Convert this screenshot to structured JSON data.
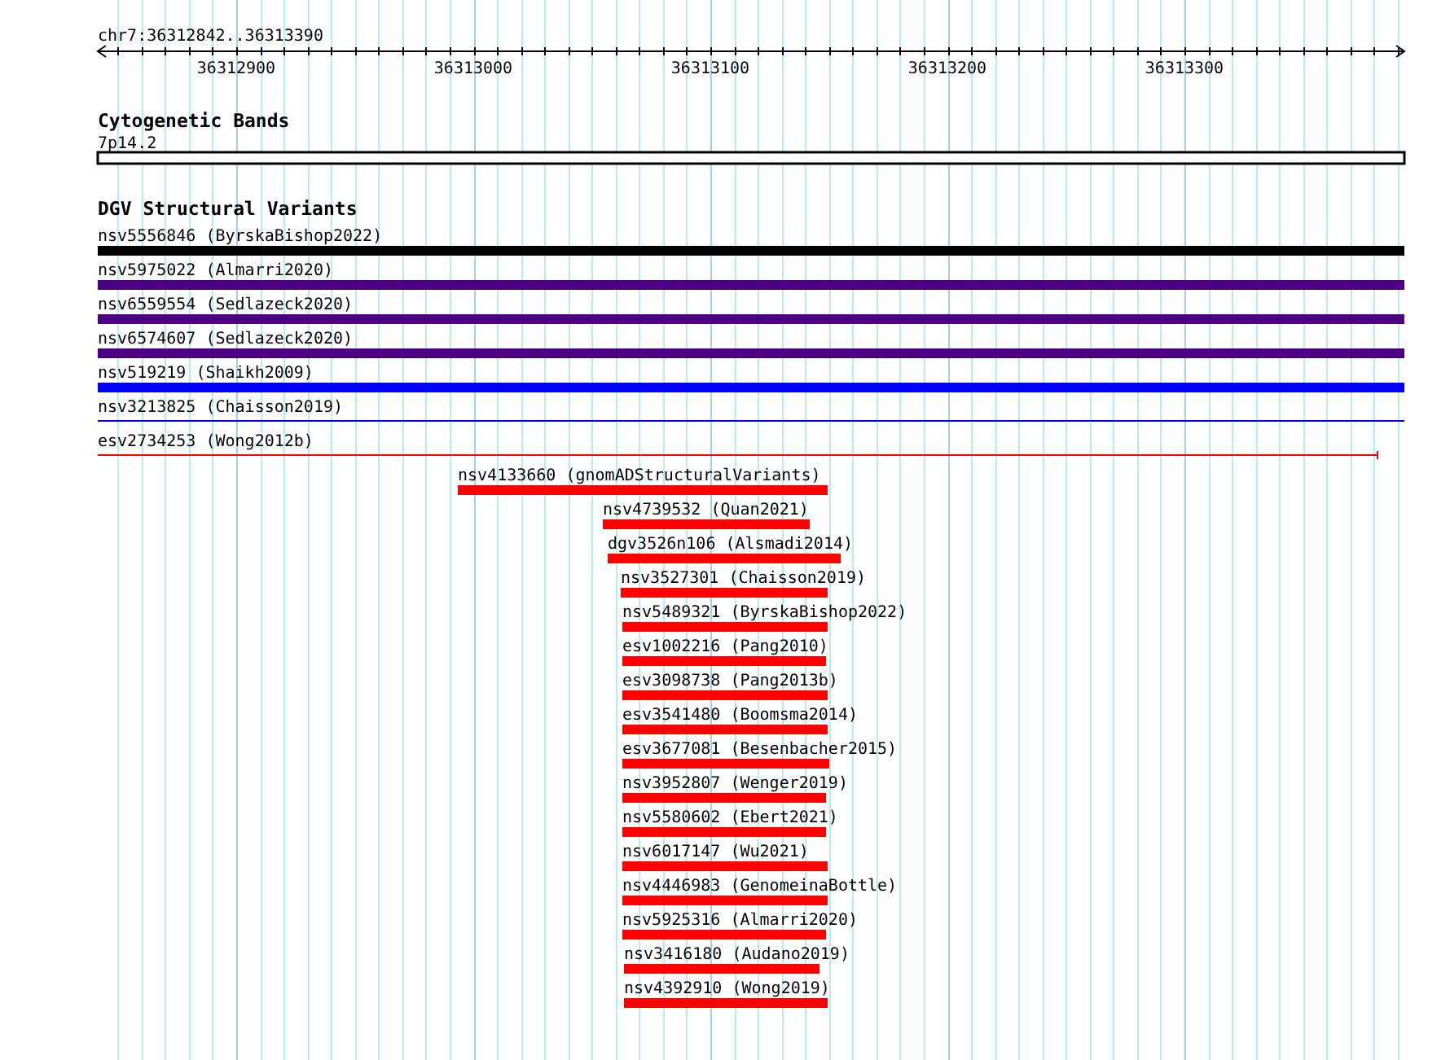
{
  "ruler": {
    "label": "chr7:36312842..36313390",
    "ticks": [
      "36312900",
      "36313000",
      "36313100",
      "36313200",
      "36313300"
    ]
  },
  "tracks": [
    {
      "title": "Cytogenetic Bands",
      "kind": "bands",
      "features": [
        {
          "label": "7p14.2"
        }
      ]
    },
    {
      "title": "DGV Structural Variants",
      "kind": "variants",
      "features": [
        {
          "label": "nsv5556846 (ByrskaBishop2022)",
          "kind": "bar",
          "color": "#000000"
        },
        {
          "label": "nsv5975022 (Almarri2020)",
          "kind": "bar",
          "color": "#4b0082"
        },
        {
          "label": "nsv6559554 (Sedlazeck2020)",
          "kind": "bar",
          "color": "#4b0082"
        },
        {
          "label": "nsv6574607 (Sedlazeck2020)",
          "kind": "bar",
          "color": "#4b0082"
        },
        {
          "label": "nsv519219 (Shaikh2009)",
          "kind": "bar",
          "color": "#0000ff"
        },
        {
          "label": "nsv3213825 (Chaisson2019)",
          "kind": "line",
          "color": "#0000ff"
        },
        {
          "label": "esv2734253 (Wong2012b)",
          "kind": "line",
          "color": "#ff0000"
        },
        {
          "label": "nsv4133660 (gnomADStructuralVariants)",
          "kind": "bar",
          "color": "#ff0000"
        },
        {
          "label": "nsv4739532 (Quan2021)",
          "kind": "bar",
          "color": "#ff0000"
        },
        {
          "label": "dgv3526n106 (Alsmadi2014)",
          "kind": "bar",
          "color": "#ff0000"
        },
        {
          "label": "nsv3527301 (Chaisson2019)",
          "kind": "bar",
          "color": "#ff0000"
        },
        {
          "label": "nsv5489321 (ByrskaBishop2022)",
          "kind": "bar",
          "color": "#ff0000"
        },
        {
          "label": "esv1002216 (Pang2010)",
          "kind": "bar",
          "color": "#ff0000"
        },
        {
          "label": "esv3098738 (Pang2013b)",
          "kind": "bar",
          "color": "#ff0000"
        },
        {
          "label": "esv3541480 (Boomsma2014)",
          "kind": "bar",
          "color": "#ff0000"
        },
        {
          "label": "esv3677081 (Besenbacher2015)",
          "kind": "bar",
          "color": "#ff0000"
        },
        {
          "label": "nsv3952807 (Wenger2019)",
          "kind": "bar",
          "color": "#ff0000"
        },
        {
          "label": "nsv5580602 (Ebert2021)",
          "kind": "bar",
          "color": "#ff0000"
        },
        {
          "label": "nsv6017147 (Wu2021)",
          "kind": "bar",
          "color": "#ff0000"
        },
        {
          "label": "nsv4446983 (GenomeinaBottle)",
          "kind": "bar",
          "color": "#ff0000"
        },
        {
          "label": "nsv5925316 (Almarri2020)",
          "kind": "bar",
          "color": "#ff0000"
        },
        {
          "label": "nsv3416180 (Audano2019)",
          "kind": "bar",
          "color": "#ff0000"
        },
        {
          "label": "nsv4392910 (Wong2019)",
          "kind": "bar",
          "color": "#ff0000"
        }
      ]
    }
  ]
}
